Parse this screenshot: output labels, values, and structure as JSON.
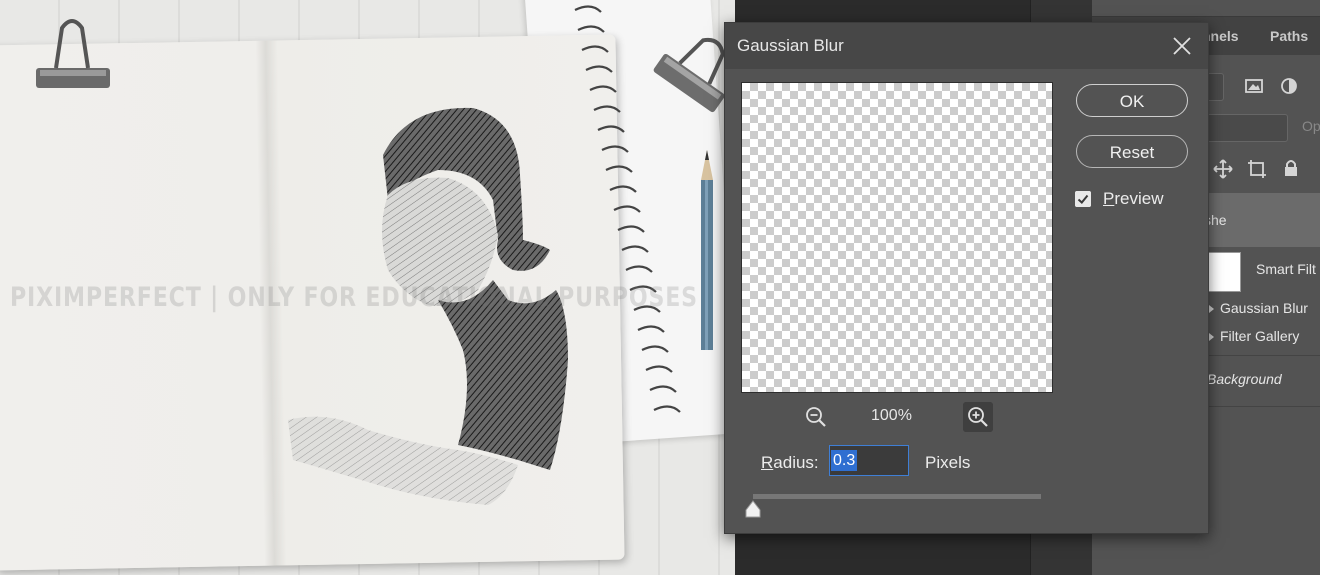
{
  "canvas": {
    "watermark": "PIXIMPERFECT | ONLY FOR EDUCATIONAL PURPOSES"
  },
  "layers_panel": {
    "tabs": [
      "Channels",
      "Paths"
    ],
    "visible_tab_text": [
      "nnels",
      "Paths"
    ],
    "opacity_label": "Op",
    "layers": [
      {
        "name": "she",
        "selected": true
      },
      {
        "name": "Background",
        "italic": true
      }
    ],
    "smart_filters_label": "Smart Filt",
    "filters": [
      "Gaussian Blur",
      "Filter Gallery"
    ]
  },
  "dialog": {
    "title": "Gaussian Blur",
    "ok_label": "OK",
    "reset_label": "Reset",
    "preview_label": "Preview",
    "preview_checked": true,
    "zoom_level": "100%",
    "radius_label": "Radius:",
    "radius_value": "0.3",
    "radius_unit": "Pixels",
    "slider_fraction": 0.0
  },
  "icons": {
    "close": "close-icon",
    "zoom_out": "zoom-out-icon",
    "zoom_in": "zoom-in-icon",
    "checkbox": "checkmark-icon",
    "slider": "slider-thumb-icon"
  },
  "colors": {
    "dialog_bg": "#535353",
    "titlebar_bg": "#474747",
    "selection_blue": "#2f6fd1",
    "selected_layer_bg": "#6b6b6b"
  }
}
